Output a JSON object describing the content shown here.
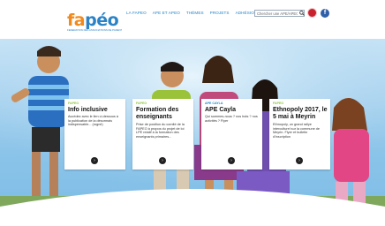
{
  "header": {
    "logo": {
      "part1": "fa",
      "part2": "péo",
      "tagline": "FÉDÉRATION DES ASSOCIATIONS DE PARENTS D'ÉLÈVES DE L'ENSEIGNEMENT OBLIGATOIRE"
    },
    "nav": [
      "LA FAPEO",
      "APE ET APEO",
      "THÈMES",
      "PROJETS",
      "ADHÉSION"
    ],
    "search_placeholder": "Chercher une APE/APEO",
    "facebook_label": "f"
  },
  "cards": [
    {
      "tag": "FAPEO",
      "tag_color": "#8cc63f",
      "title": "Info inclusive",
      "text": "Accédez avec le lien ci-dessous à la publication de la désormais indispensable... (rogné)",
      "arrow": "›"
    },
    {
      "tag": "FAPEO",
      "tag_color": "#8cc63f",
      "title": "Formation des enseignants",
      "text": "Prise de position du comité de la FAPEO à propos du projet de loi LPE relatif à la formation des enseignants primaires...",
      "arrow": "›"
    },
    {
      "tag": "APE CAYLA",
      "tag_color": "#1f82c9",
      "title": "APE Cayla",
      "text": "Qui sommes-nous ? nos buts ? nos activités ? Flyer",
      "arrow": "›"
    },
    {
      "tag": "FAPEO",
      "tag_color": "#8cc63f",
      "title": "Ethnopoly 2017, le 5 mai à Meyrin",
      "text": "Ethnopoly, un grand rallye interculturel sur la commune de Meyrin. Flyer et bulletin d'inscription",
      "arrow": "›"
    }
  ]
}
